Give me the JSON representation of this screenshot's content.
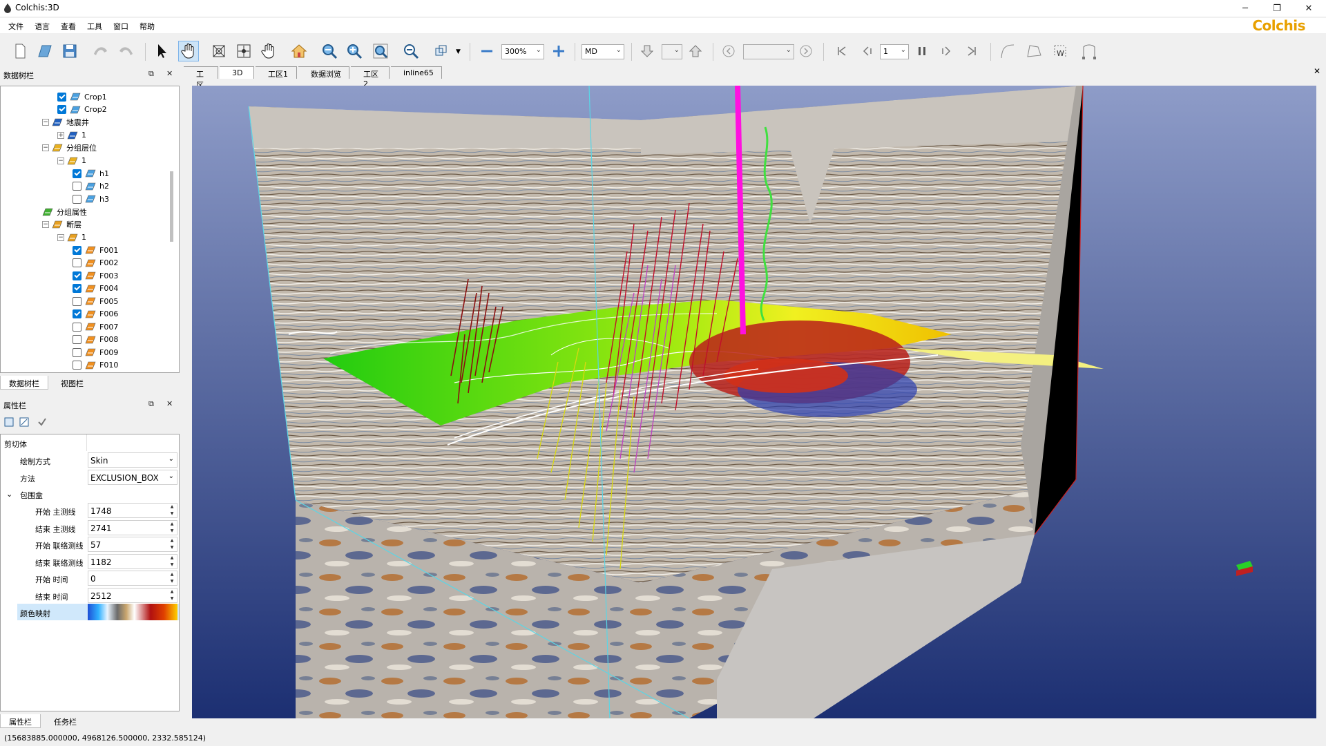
{
  "window": {
    "title": "Colchis:3D",
    "brand": "Colchis",
    "controls": [
      "minimize-icon",
      "restore-icon",
      "close-icon"
    ]
  },
  "menu": [
    "文件",
    "语言",
    "查看",
    "工具",
    "窗口",
    "帮助"
  ],
  "toolbar": {
    "zoom_value": "300%",
    "depth_mode": "MD",
    "frame_value": "1",
    "icons": [
      "new-file-icon",
      "open-file-icon",
      "save-icon",
      "undo-icon",
      "redo-icon",
      "select-pointer-icon",
      "pan-hand-icon",
      "rotate-icon",
      "move-cross-icon",
      "grab-hand-icon",
      "home-view-icon",
      "zoom-out-icon",
      "zoom-in-icon",
      "zoom-fit-icon",
      "zoom-box-icon",
      "render-mode-icon",
      "zoom-minus-icon",
      "zoom-plus-icon",
      "arrow-down-icon",
      "arrow-up-icon",
      "prev-icon",
      "next-icon",
      "first-frame-icon",
      "step-back-icon",
      "pause-icon",
      "step-forward-icon",
      "last-frame-icon",
      "curve-icon",
      "polygon-icon",
      "well-log-icon",
      "bezier-icon"
    ]
  },
  "data_tree": {
    "title": "数据树栏",
    "items": [
      {
        "label": "Crop1",
        "level": 4,
        "checkbox": true,
        "checked": true,
        "icon": "crop-icon"
      },
      {
        "label": "Crop2",
        "level": 4,
        "checkbox": true,
        "checked": true,
        "icon": "crop-icon"
      },
      {
        "label": "地震井",
        "level": 3,
        "expander": "−",
        "icon": "well-icon"
      },
      {
        "label": "1",
        "level": 4,
        "expander": "+",
        "icon": "well-icon"
      },
      {
        "label": "分组层位",
        "level": 3,
        "expander": "−",
        "icon": "horizon-group-icon"
      },
      {
        "label": "1",
        "level": 4,
        "expander": "−",
        "icon": "horizon-group-icon"
      },
      {
        "label": "h1",
        "level": 5,
        "checkbox": true,
        "checked": true,
        "icon": "horizon-icon"
      },
      {
        "label": "h2",
        "level": 5,
        "checkbox": true,
        "checked": false,
        "icon": "horizon-icon"
      },
      {
        "label": "h3",
        "level": 5,
        "checkbox": true,
        "checked": false,
        "icon": "horizon-icon"
      },
      {
        "label": "分组属性",
        "level": 3,
        "icon": "attribute-group-icon"
      },
      {
        "label": "断层",
        "level": 3,
        "expander": "−",
        "icon": "fault-group-icon"
      },
      {
        "label": "1",
        "level": 4,
        "expander": "−",
        "icon": "fault-group-icon"
      },
      {
        "label": "F001",
        "level": 5,
        "checkbox": true,
        "checked": true,
        "icon": "fault-icon"
      },
      {
        "label": "F002",
        "level": 5,
        "checkbox": true,
        "checked": false,
        "icon": "fault-icon"
      },
      {
        "label": "F003",
        "level": 5,
        "checkbox": true,
        "checked": true,
        "icon": "fault-icon"
      },
      {
        "label": "F004",
        "level": 5,
        "checkbox": true,
        "checked": true,
        "icon": "fault-icon"
      },
      {
        "label": "F005",
        "level": 5,
        "checkbox": true,
        "checked": false,
        "icon": "fault-icon"
      },
      {
        "label": "F006",
        "level": 5,
        "checkbox": true,
        "checked": true,
        "icon": "fault-icon"
      },
      {
        "label": "F007",
        "level": 5,
        "checkbox": true,
        "checked": false,
        "icon": "fault-icon"
      },
      {
        "label": "F008",
        "level": 5,
        "checkbox": true,
        "checked": false,
        "icon": "fault-icon"
      },
      {
        "label": "F009",
        "level": 5,
        "checkbox": true,
        "checked": false,
        "icon": "fault-icon"
      },
      {
        "label": "F010",
        "level": 5,
        "checkbox": true,
        "checked": false,
        "icon": "fault-icon"
      }
    ],
    "tabs": [
      "数据树栏",
      "视图栏"
    ]
  },
  "properties": {
    "title": "属性栏",
    "section": "剪切体",
    "draw_mode_label": "绘制方式",
    "draw_mode_value": "Skin",
    "method_label": "方法",
    "method_value": "EXCLUSION_BOX",
    "bbox_label": "包围盒",
    "fields": [
      {
        "label": "开始 主测线",
        "value": "1748"
      },
      {
        "label": "结束 主测线",
        "value": "2741"
      },
      {
        "label": "开始 联络测线",
        "value": "57"
      },
      {
        "label": "结束 联络测线",
        "value": "1182"
      },
      {
        "label": "开始 时间",
        "value": "0"
      },
      {
        "label": "结束 时间",
        "value": "2512"
      }
    ],
    "colormap_label": "颜色映射",
    "tabs": [
      "属性栏",
      "任务栏"
    ]
  },
  "view_tabs": [
    "工区",
    "3D",
    "工区1",
    "数据浏览",
    "工区2",
    "inline65"
  ],
  "view_tab_selected": "3D",
  "status": "(15683885.000000, 4968126.500000, 2332.585124)",
  "colors": {
    "accent": "#0078d7",
    "brand": "#e8a000",
    "sky_top": "#8e9cc8",
    "sky_bottom": "#1c2f72"
  }
}
